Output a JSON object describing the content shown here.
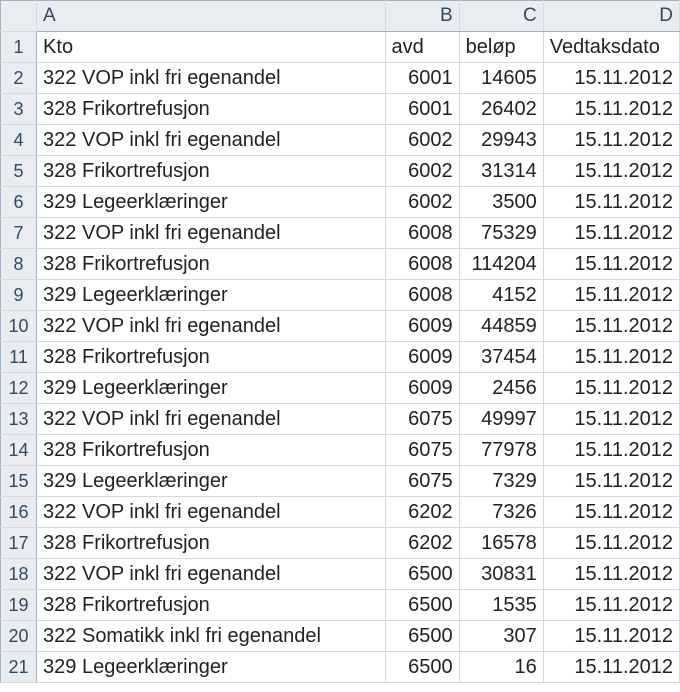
{
  "chart_data": {
    "type": "table",
    "columns": [
      "Kto",
      "avd",
      "beløp",
      "Vedtaksdato"
    ],
    "rows": [
      [
        "322 VOP inkl fri egenandel",
        6001,
        14605,
        "15.11.2012"
      ],
      [
        "328 Frikortrefusjon",
        6001,
        26402,
        "15.11.2012"
      ],
      [
        "322 VOP inkl fri egenandel",
        6002,
        29943,
        "15.11.2012"
      ],
      [
        "328 Frikortrefusjon",
        6002,
        31314,
        "15.11.2012"
      ],
      [
        "329 Legeerklæringer",
        6002,
        3500,
        "15.11.2012"
      ],
      [
        "322 VOP inkl fri egenandel",
        6008,
        75329,
        "15.11.2012"
      ],
      [
        "328 Frikortrefusjon",
        6008,
        114204,
        "15.11.2012"
      ],
      [
        "329 Legeerklæringer",
        6008,
        4152,
        "15.11.2012"
      ],
      [
        "322 VOP inkl fri egenandel",
        6009,
        44859,
        "15.11.2012"
      ],
      [
        "328 Frikortrefusjon",
        6009,
        37454,
        "15.11.2012"
      ],
      [
        "329 Legeerklæringer",
        6009,
        2456,
        "15.11.2012"
      ],
      [
        "322 VOP inkl fri egenandel",
        6075,
        49997,
        "15.11.2012"
      ],
      [
        "328 Frikortrefusjon",
        6075,
        77978,
        "15.11.2012"
      ],
      [
        "329 Legeerklæringer",
        6075,
        7329,
        "15.11.2012"
      ],
      [
        "322 VOP inkl fri egenandel",
        6202,
        7326,
        "15.11.2012"
      ],
      [
        "328 Frikortrefusjon",
        6202,
        16578,
        "15.11.2012"
      ],
      [
        "322 VOP inkl fri egenandel",
        6500,
        30831,
        "15.11.2012"
      ],
      [
        "328 Frikortrefusjon",
        6500,
        1535,
        "15.11.2012"
      ],
      [
        "322 Somatikk inkl fri egenandel",
        6500,
        307,
        "15.11.2012"
      ],
      [
        "329 Legeerklæringer",
        6500,
        16,
        "15.11.2012"
      ]
    ]
  },
  "col_letters": [
    "A",
    "B",
    "C",
    "D"
  ]
}
